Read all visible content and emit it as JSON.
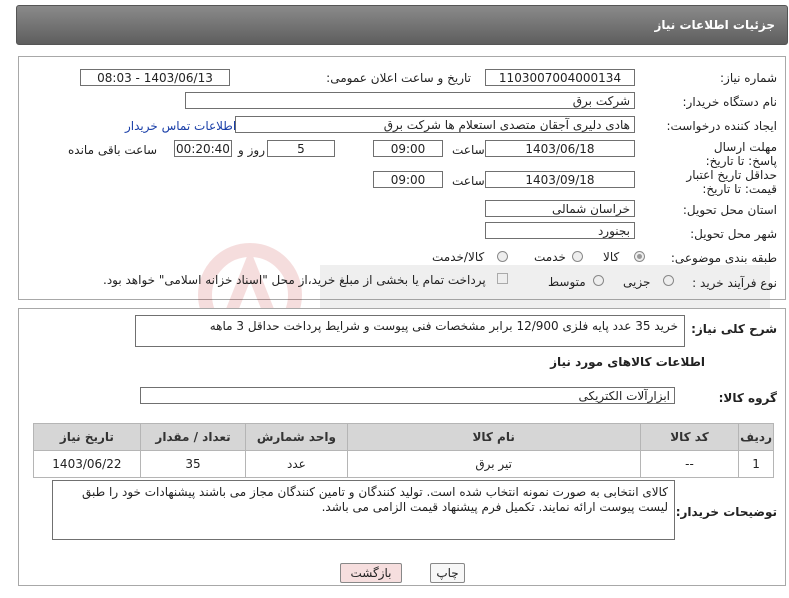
{
  "header": {
    "title": "جزئیات اطلاعات نیاز"
  },
  "form": {
    "need_number_label": "شماره نیاز:",
    "need_number": "1103007004000134",
    "announce_label": "تاریخ و ساعت اعلان عمومی:",
    "announce_value": "1403/06/13 - 08:03",
    "buyer_org_label": "نام دستگاه خریدار:",
    "buyer_org": "شرکت برق",
    "requester_label": "ایجاد کننده درخواست:",
    "requester": "هادی دلیری آجقان متصدی استعلام ها  شرکت برق",
    "contact_link": "اطلاعات تماس خریدار",
    "reply_deadline_label": "مهلت ارسال پاسخ: تا تاریخ:",
    "reply_date": "1403/06/18",
    "time_label": "ساعت",
    "reply_time": "09:00",
    "days_value": "5",
    "days_label": "روز و",
    "remaining_time": "00:20:40",
    "remaining_label": "ساعت باقی مانده",
    "validity_label": "حداقل تاریخ اعتبار قیمت: تا تاریخ:",
    "validity_date": "1403/09/18",
    "validity_time": "09:00",
    "province_label": "استان محل تحویل:",
    "province": "خراسان شمالی",
    "city_label": "شهر محل تحویل:",
    "city": "بجنورد",
    "category_label": "طبقه بندی موضوعی:",
    "category_options": [
      "کالا",
      "خدمت",
      "کالا/خدمت"
    ],
    "process_label": "نوع فرآیند خرید :",
    "process_options": [
      "جزیی",
      "متوسط"
    ],
    "payment_note": "پرداخت تمام یا بخشی از مبلغ خرید،از محل \"اسناد خزانه اسلامی\" خواهد بود."
  },
  "description": {
    "label": "شرح کلی نیاز:",
    "text": "خرید 35 عدد پایه فلزی 12/900 برابر مشخصات فنی پیوست و شرایط پرداخت حداقل 3 ماهه"
  },
  "goods_info": {
    "title": "اطلاعات کالاهای مورد نیاز",
    "group_label": "گروه کالا:",
    "group": "ابزارآلات الکتریکی"
  },
  "table": {
    "headers": [
      "ردیف",
      "کد کالا",
      "نام کالا",
      "واحد شمارش",
      "تعداد / مقدار",
      "تاریخ نیاز"
    ],
    "rows": [
      [
        "1",
        "--",
        "تیر برق",
        "عدد",
        "35",
        "1403/06/22"
      ]
    ]
  },
  "buyer_notes": {
    "label": "توضیحات خریدار:",
    "text": "کالای انتخابی به صورت نمونه انتخاب شده است. تولید کنندگان و تامین کنندگان مجاز می باشند پیشنهادات خود را طبق لیست پیوست ارائه نمایند. تکمیل فرم پیشنهاد قیمت الزامی می باشد."
  },
  "buttons": {
    "print": "چاپ",
    "back": "بازگشت"
  },
  "colors": {
    "header_bg": "#6e6e6e",
    "link": "#1a3fa8",
    "table_header": "#d6d6d6",
    "back_button": "#f6dede"
  }
}
